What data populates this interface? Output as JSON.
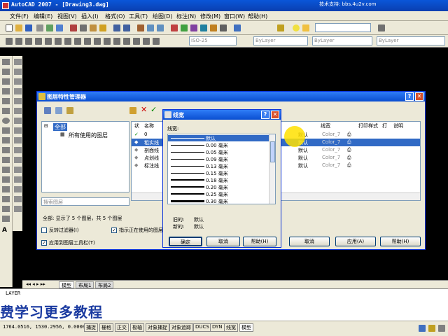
{
  "window": {
    "title": "AutoCAD 2007 - [Drawing3.dwg]",
    "site_text": "技术支持: bbs.4u2v.com"
  },
  "menu": [
    "文件(F)",
    "编辑(E)",
    "视图(V)",
    "插入(I)",
    "格式(O)",
    "工具(T)",
    "绘图(D)",
    "标注(N)",
    "修改(M)",
    "窗口(W)",
    "帮助(H)"
  ],
  "toolbar": {
    "dimstyle": "ISO-25",
    "layer_combo": "ByLayer",
    "linetype_combo": "ByLayer",
    "lineweight_combo": "ByLayer"
  },
  "layer_manager": {
    "title": "图层特性管理器",
    "tree_root": "全部",
    "tree_child": "所有使用的图层",
    "search_placeholder": "搜索图层",
    "columns": [
      "状",
      "名称",
      "线宽",
      "打印样式",
      "打",
      "说明"
    ],
    "rows": [
      {
        "name": "0",
        "lineweight": "默认",
        "plotstyle": "Color_7"
      },
      {
        "name": "粗实线",
        "lineweight": "默认",
        "plotstyle": "Color_7"
      },
      {
        "name": "剖面线",
        "lineweight": "默认",
        "plotstyle": "Color_7"
      },
      {
        "name": "点划线",
        "lineweight": "默认",
        "plotstyle": "Color_7"
      },
      {
        "name": "标注线",
        "lineweight": "默认",
        "plotstyle": "Color_7"
      }
    ],
    "summary": "全部: 显示了 5 个图层，共 5 个图层",
    "invert_filter": "反转过滤器(I)",
    "indicate_used": "指示正在使用的图层",
    "apply_toolbar": "应用到图层工具栏(T)",
    "btn_cancel": "取消",
    "btn_apply": "应用(A)",
    "btn_help": "帮助(H)"
  },
  "lineweight_dialog": {
    "title": "线宽",
    "label": "线宽:",
    "items": [
      "默认",
      "0.00 毫米",
      "0.05 毫米",
      "0.09 毫米",
      "0.13 毫米",
      "0.15 毫米",
      "0.18 毫米",
      "0.20 毫米",
      "0.25 毫米",
      "0.30 毫米"
    ],
    "old_label": "旧的:",
    "old_value": "默认",
    "new_label": "新的:",
    "new_value": "默认",
    "btn_ok": "确定",
    "btn_cancel": "取消",
    "btn_help": "帮助(H)"
  },
  "tabs": [
    "模型",
    "布局1",
    "布局2"
  ],
  "command_line": "LAYER",
  "promo": "费学习更多教程",
  "status": {
    "coords": "1764.0516, 1530.2956, 0.0000",
    "buttons": [
      "捕捉",
      "栅格",
      "正交",
      "极轴",
      "对象捕捉",
      "对象追踪",
      "DUCS",
      "DYN",
      "线宽",
      "模型"
    ]
  }
}
